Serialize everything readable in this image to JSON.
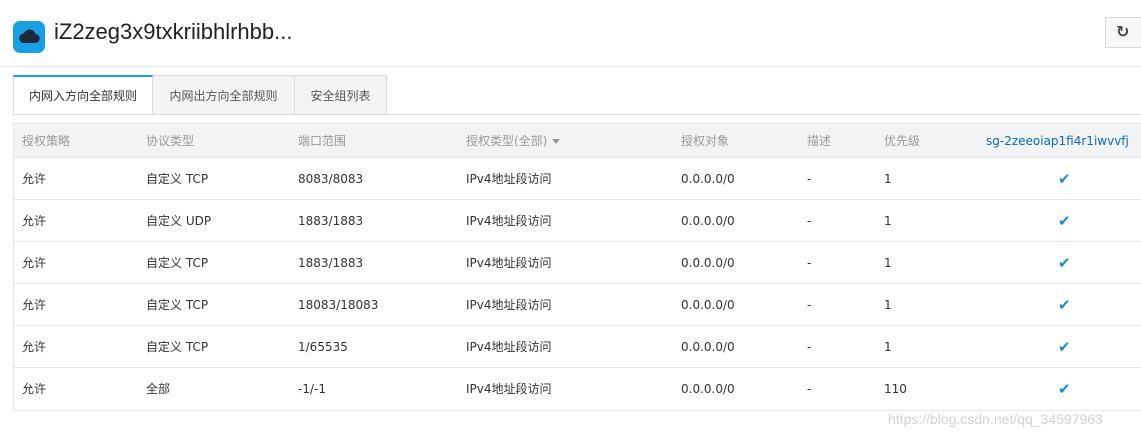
{
  "header": {
    "title": "iZ2zeg3x9txkriibhlrhbb...",
    "refresh_icon": "refresh-icon",
    "app_icon": "cloud-icon"
  },
  "tabs": [
    {
      "label": "内网入方向全部规则",
      "active": true
    },
    {
      "label": "内网出方向全部规则",
      "active": false
    },
    {
      "label": "安全组列表",
      "active": false
    }
  ],
  "table": {
    "columns": {
      "policy": "授权策略",
      "protocol": "协议类型",
      "port": "端口范围",
      "auth_type": "授权类型(全部)",
      "object": "授权对象",
      "desc": "描述",
      "priority": "优先级",
      "security_group": "sg-2zeeoiap1fi4r1iwvvfj"
    },
    "rows": [
      {
        "policy": "允许",
        "protocol": "自定义 TCP",
        "port": "8083/8083",
        "auth_type": "IPv4地址段访问",
        "object": "0.0.0.0/0",
        "desc": "-",
        "priority": "1",
        "check": "✔"
      },
      {
        "policy": "允许",
        "protocol": "自定义 UDP",
        "port": "1883/1883",
        "auth_type": "IPv4地址段访问",
        "object": "0.0.0.0/0",
        "desc": "-",
        "priority": "1",
        "check": "✔"
      },
      {
        "policy": "允许",
        "protocol": "自定义 TCP",
        "port": "1883/1883",
        "auth_type": "IPv4地址段访问",
        "object": "0.0.0.0/0",
        "desc": "-",
        "priority": "1",
        "check": "✔"
      },
      {
        "policy": "允许",
        "protocol": "自定义 TCP",
        "port": "18083/18083",
        "auth_type": "IPv4地址段访问",
        "object": "0.0.0.0/0",
        "desc": "-",
        "priority": "1",
        "check": "✔"
      },
      {
        "policy": "允许",
        "protocol": "自定义 TCP",
        "port": "1/65535",
        "auth_type": "IPv4地址段访问",
        "object": "0.0.0.0/0",
        "desc": "-",
        "priority": "1",
        "check": "✔"
      },
      {
        "policy": "允许",
        "protocol": "全部",
        "port": "-1/-1",
        "auth_type": "IPv4地址段访问",
        "object": "0.0.0.0/0",
        "desc": "-",
        "priority": "110",
        "check": "✔"
      }
    ]
  },
  "watermark": "https://blog.csdn.net/qq_34597963",
  "colors": {
    "accent": "#18a0e3",
    "link": "#0a6cc0",
    "check": "#1a8fc9"
  }
}
